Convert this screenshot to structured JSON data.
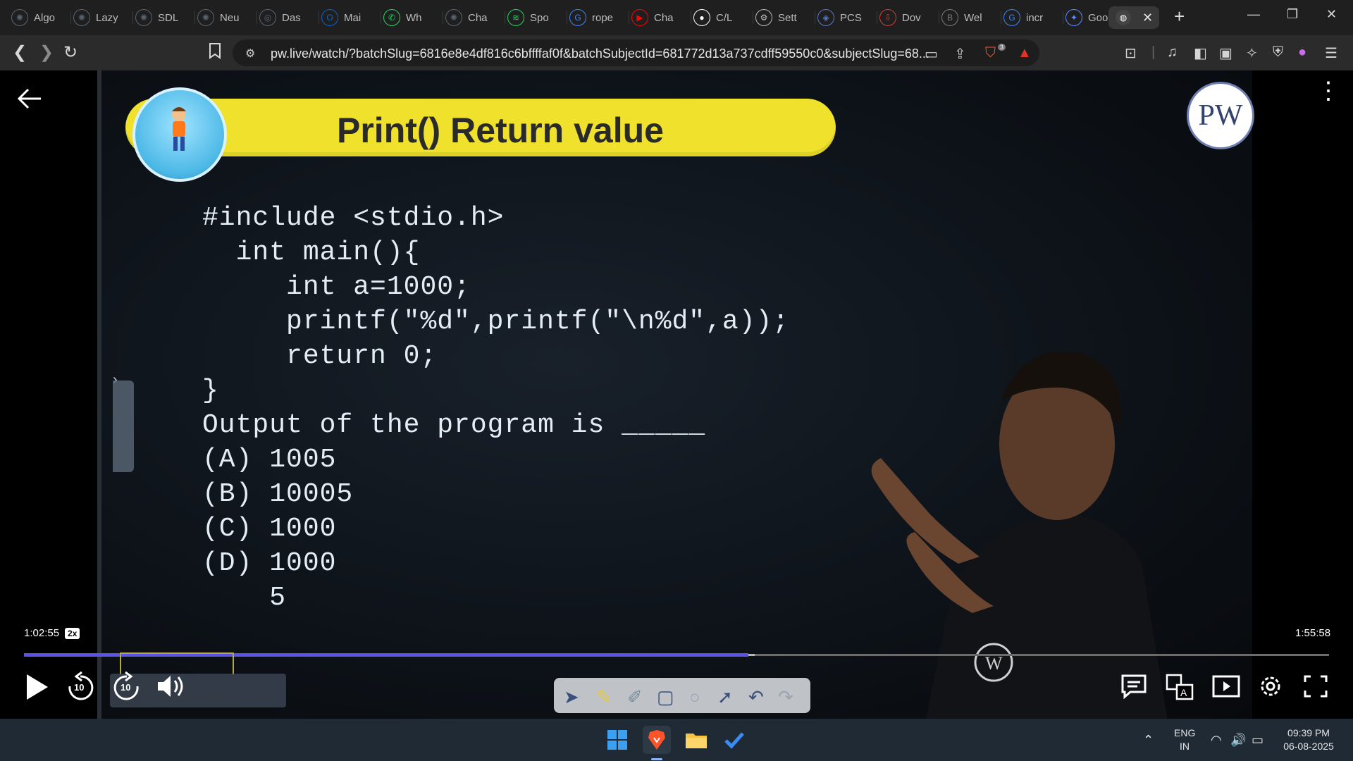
{
  "browser": {
    "tabs": [
      {
        "label": "Algo",
        "icon": "openai-icon",
        "color": "#5a6470"
      },
      {
        "label": "Lazy",
        "icon": "openai-icon",
        "color": "#5a6470"
      },
      {
        "label": "SDL",
        "icon": "openai-icon",
        "color": "#5a6470"
      },
      {
        "label": "Neu",
        "icon": "openai-icon",
        "color": "#5a6470"
      },
      {
        "label": "Das",
        "icon": "dashboard-icon",
        "color": "#5a6470"
      },
      {
        "label": "Mai",
        "icon": "outlook-icon",
        "color": "#0a64c8"
      },
      {
        "label": "Wh",
        "icon": "whatsapp-icon",
        "color": "#25d366"
      },
      {
        "label": "Cha",
        "icon": "openai-icon",
        "color": "#5a6470"
      },
      {
        "label": "Spo",
        "icon": "spotify-icon",
        "color": "#1ed760"
      },
      {
        "label": "rope",
        "icon": "google-icon",
        "color": "#4285f4"
      },
      {
        "label": "Cha",
        "icon": "youtube-icon",
        "color": "#ff0000"
      },
      {
        "label": "C/L",
        "icon": "github-icon",
        "color": "#ffffff"
      },
      {
        "label": "Sett",
        "icon": "gear-icon",
        "color": "#bdbdbd"
      },
      {
        "label": "PCS",
        "icon": "pcs-icon",
        "color": "#5a78c8"
      },
      {
        "label": "Dov",
        "icon": "download-icon",
        "color": "#c84040"
      },
      {
        "label": "Wel",
        "icon": "bookmark-b-icon",
        "color": "#7a7a7a"
      },
      {
        "label": "incr",
        "icon": "google-icon",
        "color": "#4285f4"
      },
      {
        "label": "Goo",
        "icon": "gemini-icon",
        "color": "#5a8cff"
      }
    ],
    "active_tab_close": "✕",
    "new_tab": "+",
    "url": "pw.live/watch/?batchSlug=6816e8e4df816c6bffffaf0f&batchSubjectId=681772d13a737cdff59550c0&subjectSlug=68...",
    "brave_badge": "3"
  },
  "video": {
    "banner_title": "Print() Return value",
    "logo_text": "PW",
    "code_lines": [
      "#include <stdio.h>",
      "  int main(){",
      "     int a=1000;",
      "     printf(\"%d\",printf(\"\\n%d\",a));",
      "     return 0;",
      "}",
      "Output of the program is _____",
      "(A) 1005",
      "(B) 10005",
      "(C) 1000",
      "(D) 1000",
      "    5"
    ],
    "current_time": "1:02:55",
    "speed": "2x",
    "total_time": "1:55:58",
    "progress": 0.555,
    "buffered": 0.56,
    "rewind_label": "10",
    "forward_label": "10"
  },
  "taskbar": {
    "language": "ENG",
    "region": "IN",
    "time": "09:39 PM",
    "date": "06-08-2025"
  }
}
